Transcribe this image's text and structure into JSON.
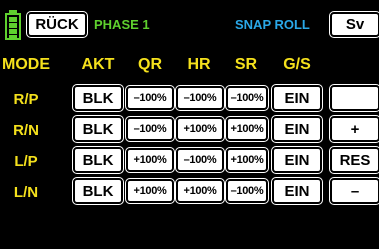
{
  "header": {
    "back_label": "RÜCK",
    "phase_label": "PHASE 1",
    "mode_title": "SNAP ROLL",
    "save_label": "Sv"
  },
  "columns": {
    "mode": "MODE",
    "akt": "AKT",
    "qr": "QR",
    "hr": "HR",
    "sr": "SR",
    "gs": "G/S"
  },
  "rows": [
    {
      "label": "R/P",
      "akt": "BLK",
      "qr": "–100%",
      "hr": "–100%",
      "sr": "–100%",
      "gs": "EIN"
    },
    {
      "label": "R/N",
      "akt": "BLK",
      "qr": "–100%",
      "hr": "+100%",
      "sr": "+100%",
      "gs": "EIN"
    },
    {
      "label": "L/P",
      "akt": "BLK",
      "qr": "+100%",
      "hr": "–100%",
      "sr": "+100%",
      "gs": "EIN"
    },
    {
      "label": "L/N",
      "akt": "BLK",
      "qr": "+100%",
      "hr": "+100%",
      "sr": "–100%",
      "gs": "EIN"
    }
  ],
  "side_buttons": {
    "plus": "+",
    "res": "RES",
    "minus": "–"
  },
  "colors": {
    "yellow": "#f5e11c",
    "green": "#5fd12e",
    "cyan": "#2aa8e8",
    "background": "#000000"
  },
  "icons": {
    "battery": "battery-icon"
  }
}
